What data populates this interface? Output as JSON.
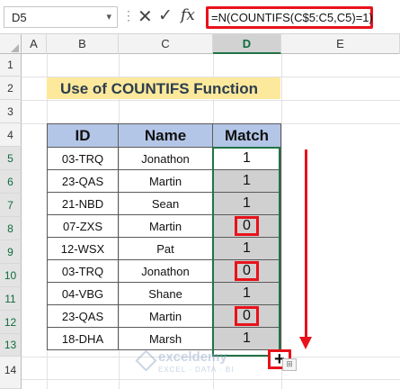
{
  "formula_bar": {
    "name_box": "D5",
    "name_box_arrow": "▾",
    "dots": "⋮",
    "cancel_icon": "✕",
    "enter_icon": "✓",
    "fx_label": "fx",
    "formula": "=N(COUNTIFS(C$5:C5,C5)=1)"
  },
  "columns": [
    "A",
    "B",
    "C",
    "D",
    "E"
  ],
  "selected_column": "D",
  "rows": [
    "1",
    "2",
    "3",
    "4",
    "5",
    "6",
    "7",
    "8",
    "9",
    "10",
    "11",
    "12",
    "13",
    "14"
  ],
  "title": "Use of COUNTIFS Function",
  "table": {
    "headers": [
      "ID",
      "Name",
      "Match"
    ],
    "rows": [
      {
        "id": "03-TRQ",
        "name": "Jonathon",
        "match": "1",
        "highlight": false
      },
      {
        "id": "23-QAS",
        "name": "Martin",
        "match": "1",
        "highlight": false
      },
      {
        "id": "21-NBD",
        "name": "Sean",
        "match": "1",
        "highlight": false
      },
      {
        "id": "07-ZXS",
        "name": "Martin",
        "match": "0",
        "highlight": true
      },
      {
        "id": "12-WSX",
        "name": "Pat",
        "match": "1",
        "highlight": false
      },
      {
        "id": "03-TRQ",
        "name": "Jonathon",
        "match": "0",
        "highlight": true
      },
      {
        "id": "04-VBG",
        "name": "Shane",
        "match": "1",
        "highlight": false
      },
      {
        "id": "23-QAS",
        "name": "Martin",
        "match": "0",
        "highlight": true
      },
      {
        "id": "18-DHA",
        "name": "Marsh",
        "match": "1",
        "highlight": false
      }
    ]
  },
  "fill_handle": "+",
  "autofill_icon": "⊞",
  "watermark": {
    "name": "exceldemy",
    "tagline": "EXCEL · DATA · BI"
  },
  "colors": {
    "accent_red": "#e8121b",
    "title_fill": "#fde99b",
    "header_fill": "#b4c6e7",
    "selection_green": "#217346"
  }
}
